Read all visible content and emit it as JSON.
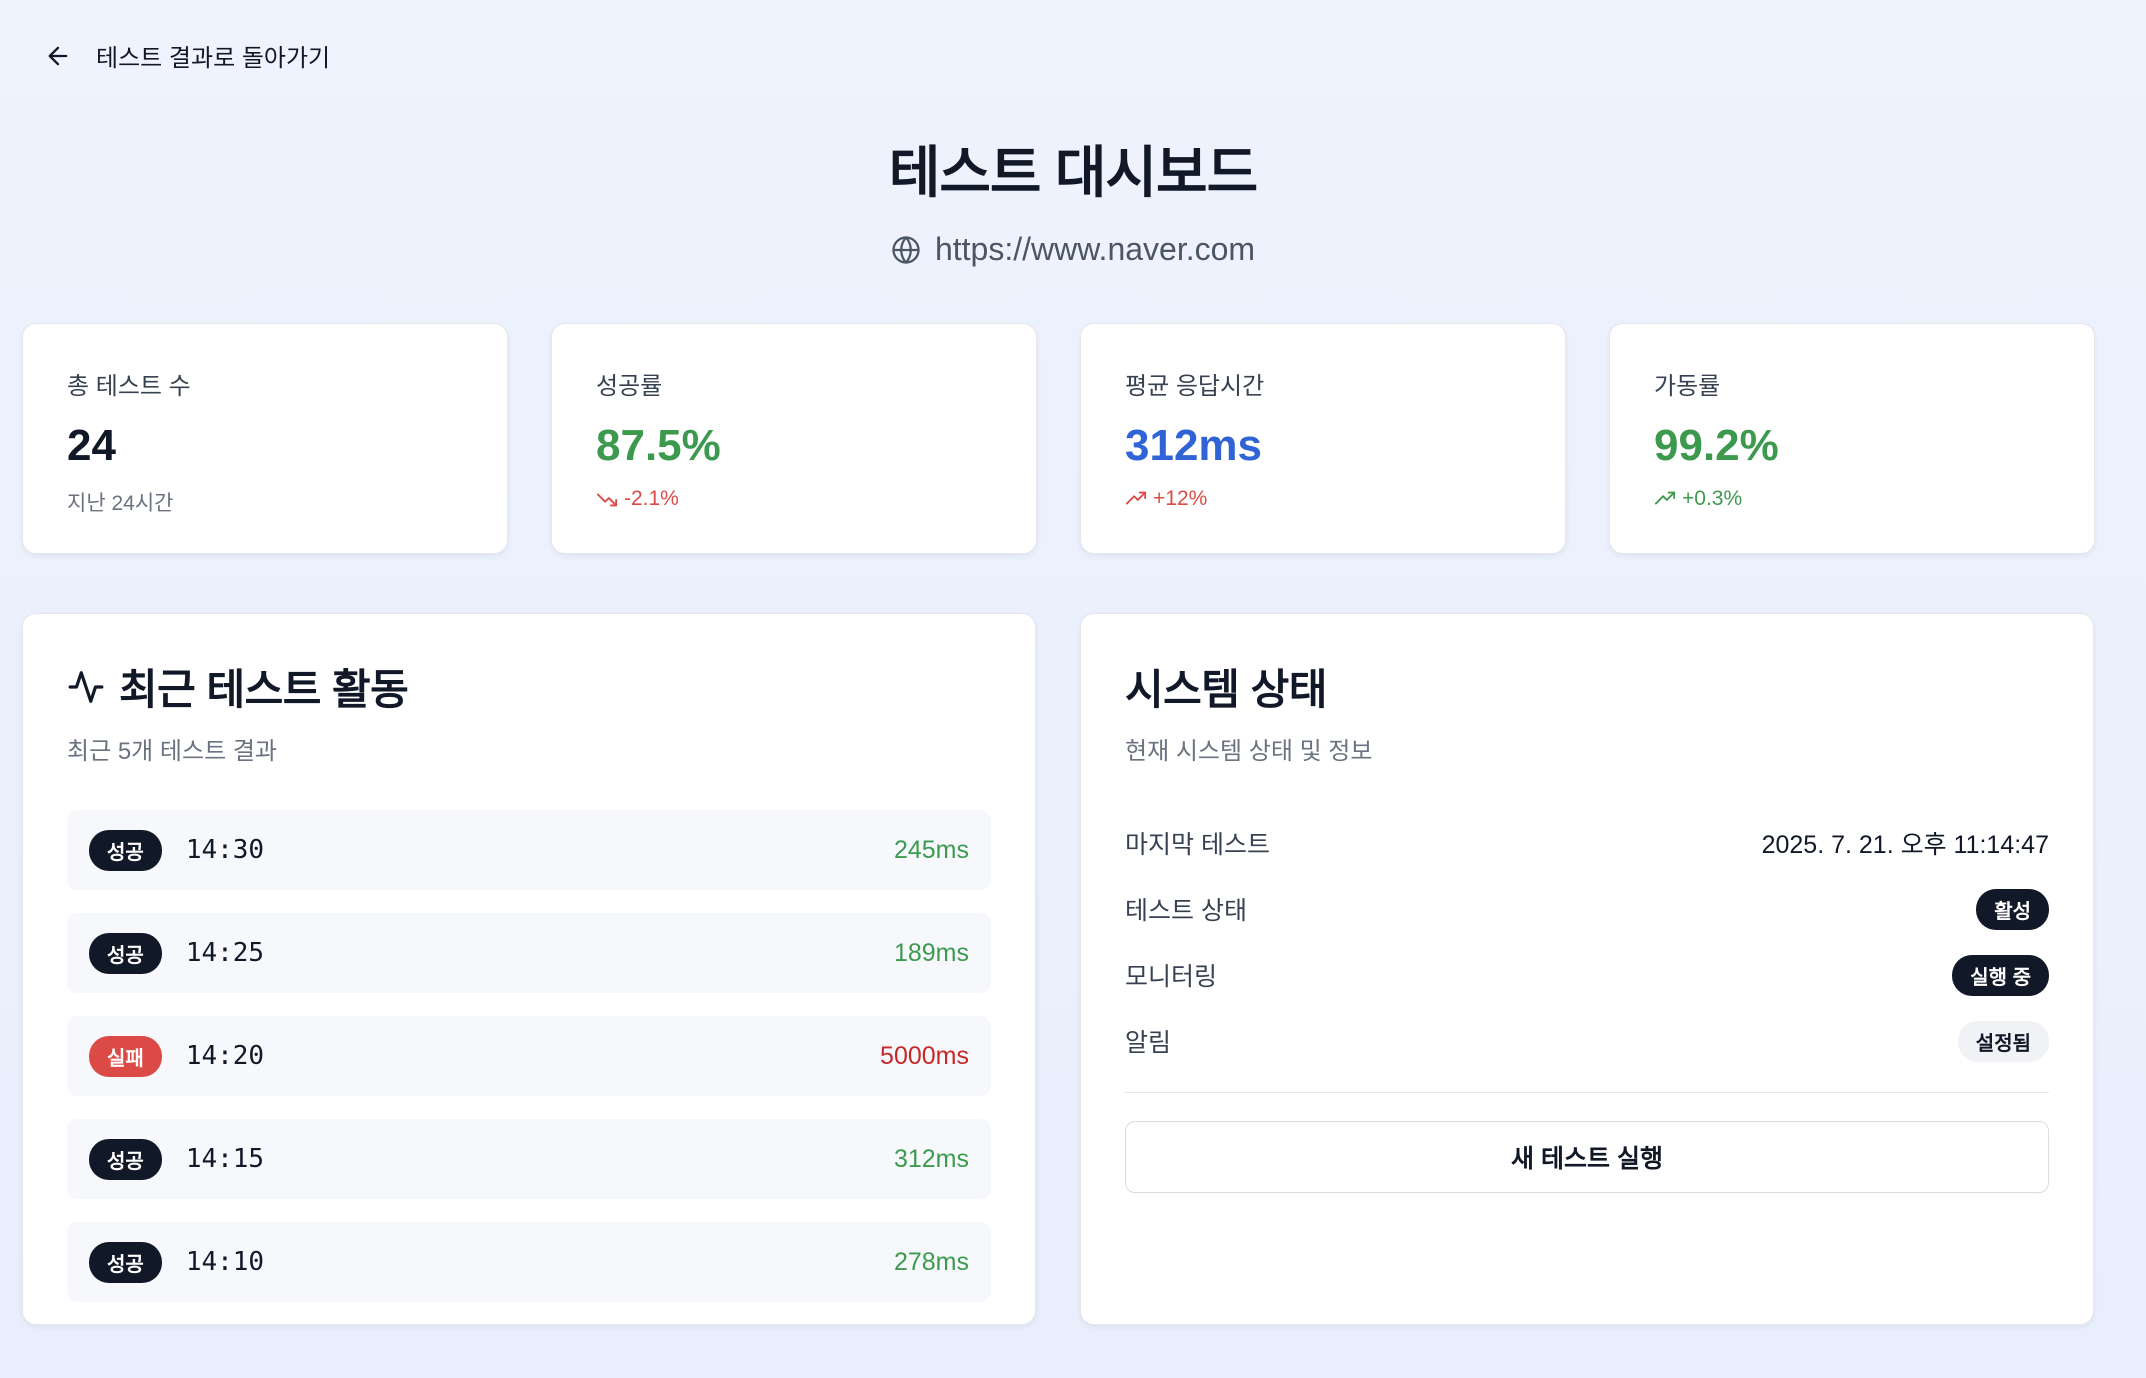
{
  "nav": {
    "back_label": "테스트 결과로 돌아가기"
  },
  "header": {
    "title": "테스트 대시보드",
    "url": "https://www.naver.com"
  },
  "colors": {
    "success": "#3c9a4f",
    "danger": "#dc4a48",
    "info": "#2f63d6",
    "dark": "#111827"
  },
  "stats": [
    {
      "label": "총 테스트 수",
      "value": "24",
      "sub": "지난 24시간"
    },
    {
      "label": "성공률",
      "value": "87.5%",
      "sub": "-2.1%",
      "trend_icon": "trending-down-icon"
    },
    {
      "label": "평균 응답시간",
      "value": "312ms",
      "sub": "+12%",
      "trend_icon": "trending-up-icon"
    },
    {
      "label": "가동률",
      "value": "99.2%",
      "sub": "+0.3%",
      "trend_icon": "trending-up-icon"
    }
  ],
  "activity": {
    "title": "최근 테스트 활동",
    "icon": "activity-icon",
    "description": "최근 5개 테스트 결과",
    "items": [
      {
        "status": "성공",
        "time": "14:30",
        "ms": "245ms"
      },
      {
        "status": "성공",
        "time": "14:25",
        "ms": "189ms"
      },
      {
        "status": "실패",
        "time": "14:20",
        "ms": "5000ms"
      },
      {
        "status": "성공",
        "time": "14:15",
        "ms": "312ms"
      },
      {
        "status": "성공",
        "time": "14:10",
        "ms": "278ms"
      }
    ]
  },
  "system": {
    "title": "시스템 상태",
    "description": "현재 시스템 상태 및 정보",
    "rows": [
      {
        "label": "마지막 테스트",
        "value": "2025. 7. 21. 오후 11:14:47"
      },
      {
        "label": "테스트 상태",
        "value": "활성"
      },
      {
        "label": "모니터링",
        "value": "실행 중"
      },
      {
        "label": "알림",
        "value": "설정됨"
      }
    ],
    "run_button": "새 테스트 실행"
  }
}
